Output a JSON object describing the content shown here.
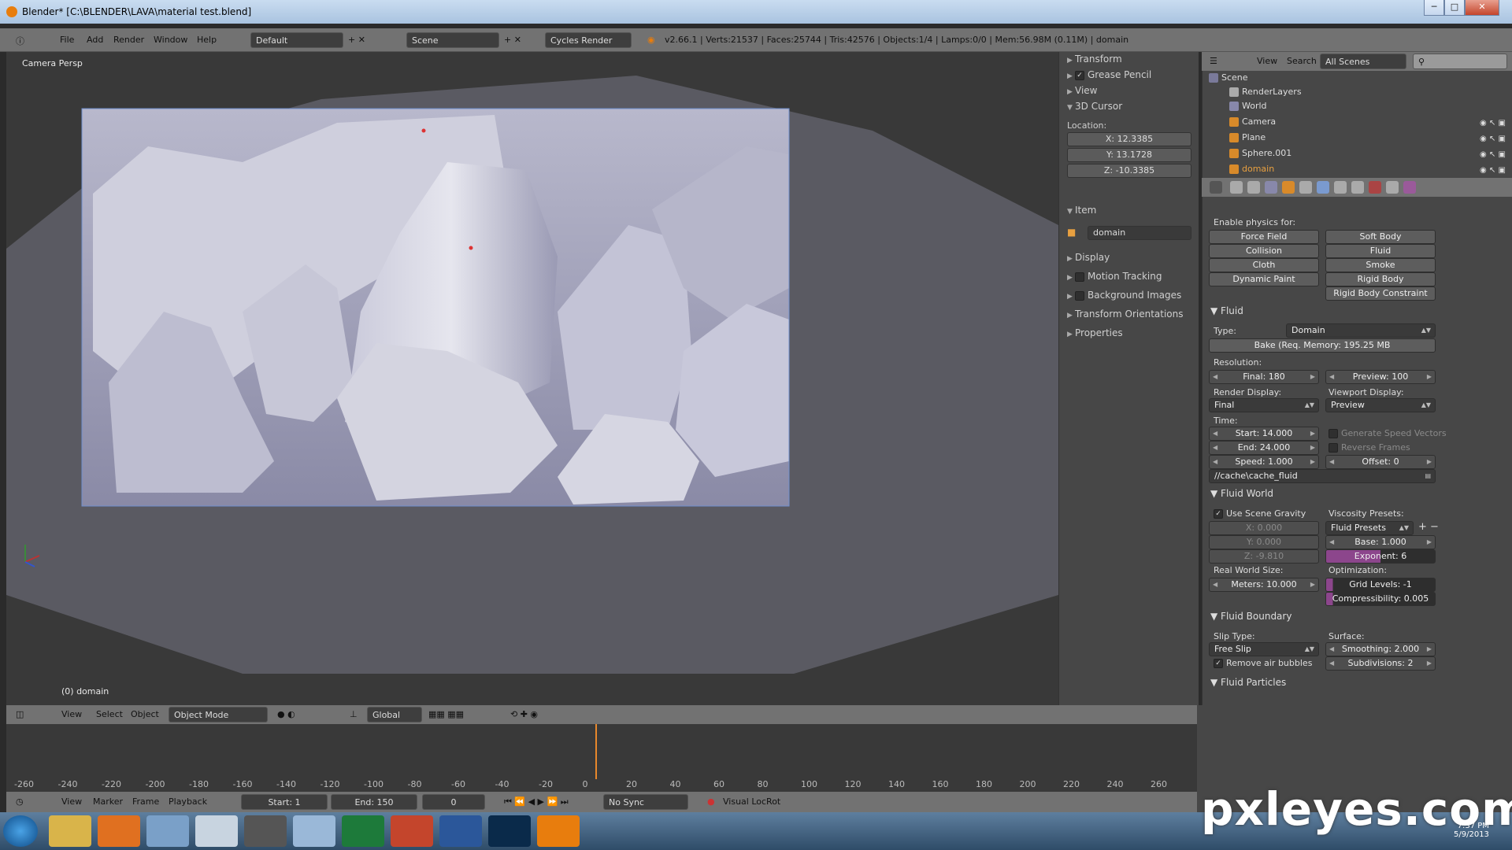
{
  "window": {
    "title": "Blender* [C:\\BLENDER\\LAVA\\material test.blend]",
    "min": "─",
    "max": "□",
    "close": "✕"
  },
  "menu": {
    "items": [
      "File",
      "Add",
      "Render",
      "Window",
      "Help"
    ],
    "layout": "Default",
    "scene": "Scene",
    "engine": "Cycles Render",
    "stats": "v2.66.1 | Verts:21537 | Faces:25744 | Tris:42576 | Objects:1/4 | Lamps:0/0 | Mem:56.98M (0.11M) | domain"
  },
  "viewport": {
    "label": "Camera Persp",
    "object": "(0) domain"
  },
  "npanel": {
    "transform": "Transform",
    "grease_pencil": "Grease Pencil",
    "view": "View",
    "cursor": "3D Cursor",
    "location": "Location:",
    "x": "X: 12.3385",
    "y": "Y: 13.1728",
    "z": "Z: -10.3385",
    "item": "Item",
    "item_name": "domain",
    "display": "Display",
    "motion_tracking": "Motion Tracking",
    "background_images": "Background Images",
    "transform_orientations": "Transform Orientations",
    "properties": "Properties"
  },
  "outliner": {
    "view": "View",
    "search": "Search",
    "scenes": "All Scenes",
    "rows": [
      "Scene",
      "RenderLayers",
      "World",
      "Camera",
      "Plane",
      "Sphere.001",
      "domain"
    ]
  },
  "physics": {
    "enable": "Enable physics for:",
    "force_field": "Force Field",
    "soft_body": "Soft Body",
    "collision": "Collision",
    "fluid": "Fluid",
    "cloth": "Cloth",
    "smoke": "Smoke",
    "dynamic_paint": "Dynamic Paint",
    "rigid_body": "Rigid Body",
    "rigid_body_constraint": "Rigid Body Constraint"
  },
  "fluid": {
    "section": "Fluid",
    "type_label": "Type:",
    "type": "Domain",
    "bake": "Bake (Req. Memory: 195.25 MB",
    "resolution": "Resolution:",
    "final": "Final: 180",
    "preview": "Preview: 100",
    "render_display": "Render Display:",
    "viewport_display": "Viewport Display:",
    "render_val": "Final",
    "viewport_val": "Preview",
    "time": "Time:",
    "start": "Start: 14.000",
    "end": "End: 24.000",
    "speed": "Speed: 1.000",
    "gen_speed": "Generate Speed Vectors",
    "reverse": "Reverse Frames",
    "offset": "Offset: 0",
    "path": "//cache\\cache_fluid"
  },
  "fluid_world": {
    "section": "Fluid World",
    "use_gravity": "Use Scene Gravity",
    "viscosity": "Viscosity Presets:",
    "presets": "Fluid Presets",
    "gx": "X: 0.000",
    "gy": "Y: 0.000",
    "gz": "Z: -9.810",
    "base": "Base: 1.000",
    "exponent": "Exponent: 6",
    "real_size": "Real World Size:",
    "optimization": "Optimization:",
    "meters": "Meters: 10.000",
    "grid": "Grid Levels: -1",
    "compress": "Compressibility: 0.005"
  },
  "fluid_boundary": {
    "section": "Fluid Boundary",
    "slip": "Slip Type:",
    "surface": "Surface:",
    "slip_val": "Free Slip",
    "smoothing": "Smoothing: 2.000",
    "remove_air": "Remove air bubbles",
    "subdivisions": "Subdivisions: 2",
    "particles": "Fluid Particles"
  },
  "vheader": {
    "view": "View",
    "select": "Select",
    "object": "Object",
    "mode": "Object Mode",
    "orientation": "Global"
  },
  "timeline": {
    "ticks": [
      "-260",
      "-240",
      "-220",
      "-200",
      "-180",
      "-160",
      "-140",
      "-120",
      "-100",
      "-80",
      "-60",
      "-40",
      "-20",
      "0",
      "20",
      "40",
      "60",
      "80",
      "100",
      "120",
      "140",
      "160",
      "180",
      "200",
      "220",
      "240",
      "260"
    ],
    "view": "View",
    "marker": "Marker",
    "frame": "Frame",
    "playback": "Playback",
    "start": "Start: 1",
    "end": "End: 150",
    "current": "0",
    "sync": "No Sync",
    "locrot": "Visual LocRot"
  },
  "watermark": "pxleyes.com",
  "clock": {
    "time": "7:37 PM",
    "date": "5/9/2013"
  }
}
